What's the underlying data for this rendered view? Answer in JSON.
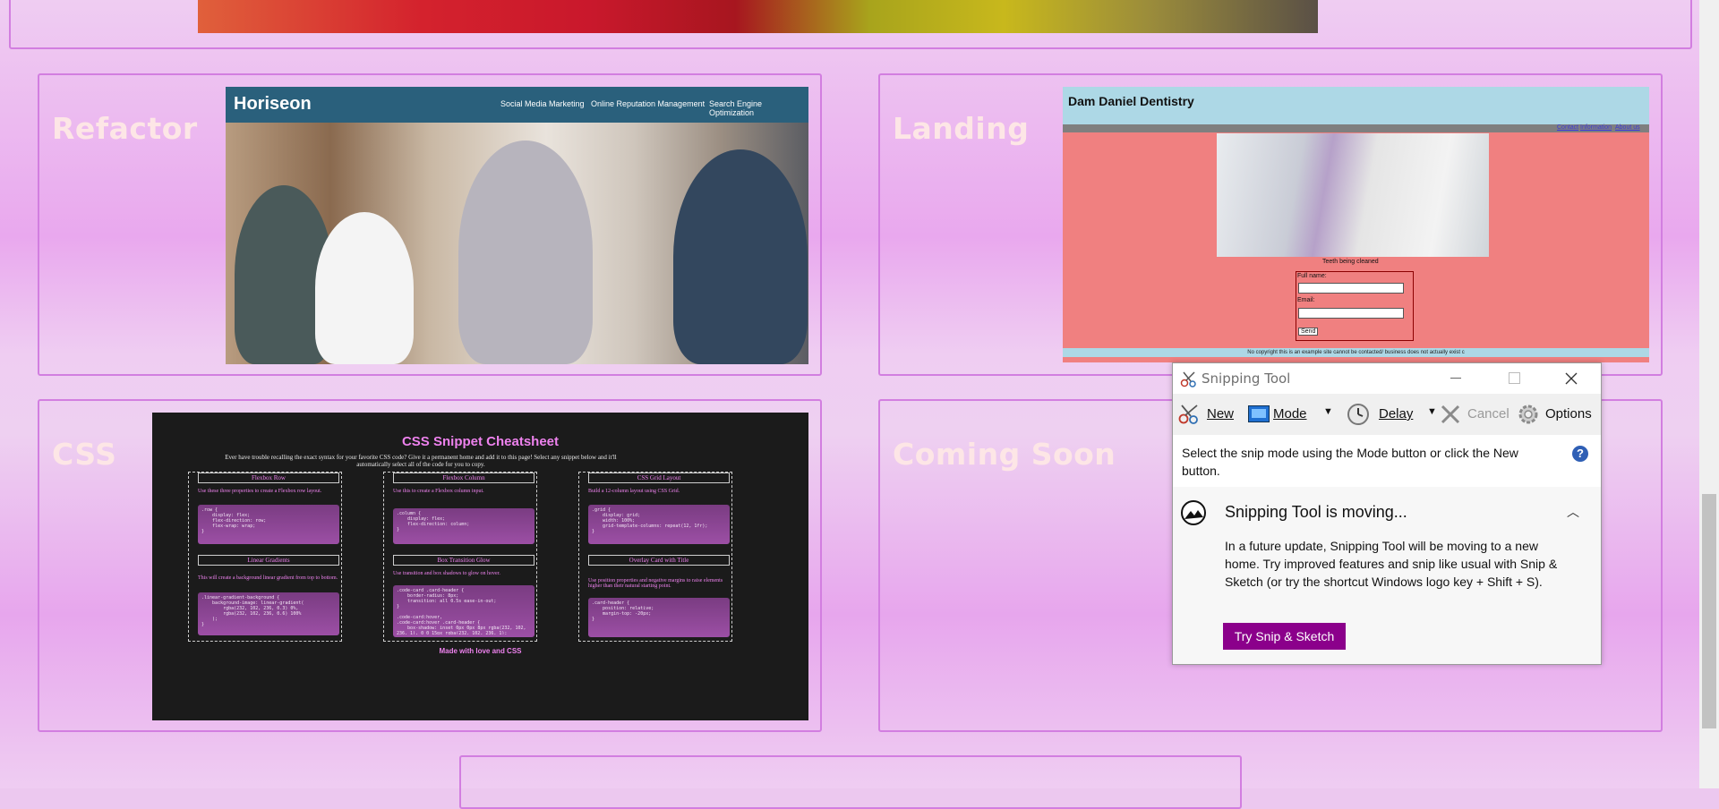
{
  "cards": {
    "refactor": {
      "label": "Refactor"
    },
    "landing": {
      "label": "Landing"
    },
    "css": {
      "label": "CSS"
    },
    "coming_soon": {
      "label": "Coming Soon"
    }
  },
  "horiseon": {
    "logo": "Horiseon",
    "nav": [
      "Social Media Marketing",
      "Online Reputation Management",
      "Search Engine Optimization"
    ]
  },
  "dentistry": {
    "title": "Dam Daniel Dentistry",
    "nav": [
      "Contact",
      "Information",
      "About us"
    ],
    "caption": "Teeth being cleaned",
    "full_name_label": "Full name:",
    "email_label": "Email:",
    "send_label": "Send",
    "footer": "No copyright this is an example site cannot be contacted/ business does not actually exist c"
  },
  "cheatsheet": {
    "title": "CSS Snippet Cheatsheet",
    "subtitle": "Ever have trouble recalling the exact syntax for your favorite CSS code? Give it a permanent home and add it to this page! Select any snippet below and it'll automatically select all of the code for you to copy.",
    "footer": "Made with love and CSS",
    "snippets": [
      {
        "heading": "Flexbox Row",
        "desc": "Use these three properties to create a Flexbox row layout.",
        "code": ".row {\n    display: flex;\n    flex-direction: row;\n    flex-wrap: wrap;\n}"
      },
      {
        "heading": "Flexbox Column",
        "desc": "Use this to create a Flexbox column input.",
        "code": ".column {\n    display: flex;\n    flex-direction: column;\n}"
      },
      {
        "heading": "CSS Grid Layout",
        "desc": "Build a 12-column layout using CSS Grid.",
        "code": ".grid {\n    display: grid;\n    width: 100%;\n    grid-template-columns: repeat(12, 1fr);\n}"
      },
      {
        "heading": "Linear Gradients",
        "desc": "This will create a background linear gradient from top to bottom.",
        "code": ".linear-gradient-background {\n    background-image: linear-gradient(\n        rgba(232, 102, 236, 0.3) 0%,\n        rgba(232, 102, 236, 0.6) 100%\n    );\n}"
      },
      {
        "heading": "Box Transition Glow",
        "desc": "Use transition and box shadows to glow on hover.",
        "code": ".code-card .card-header {\n    border-radius: 8px;\n    transition: all 0.5s ease-in-out;\n}\n\n.code-card:hover,\n.code-card:hover .card-header {\n    box-shadow: inset 0px 0px 8px rgba(232, 102, 236, 1), 0 0 15px rgba(232, 102, 236, 1);\n}"
      },
      {
        "heading": "Overlay Card with Title",
        "desc": "Use position properties and negative margins to raise elements higher than their natural starting point.",
        "code": ".card-header {\n    position: relative;\n    margin-top: -20px;\n}"
      }
    ]
  },
  "snipping_tool": {
    "title": "Snipping Tool",
    "toolbar": {
      "new": "New",
      "mode": "Mode",
      "delay": "Delay",
      "cancel": "Cancel",
      "options": "Options"
    },
    "message": "Select the snip mode using the Mode button or click the New button.",
    "notice_title": "Snipping Tool is moving...",
    "notice_body": "In a future update, Snipping Tool will be moving to a new home. Try improved features and snip like usual with Snip & Sketch (or try the shortcut Windows logo key + Shift + S).",
    "cta": "Try Snip & Sketch",
    "help": "?"
  },
  "colors": {
    "accent": "#8b008b",
    "card_border": "#d27ee0",
    "label": "#fde6e6"
  }
}
